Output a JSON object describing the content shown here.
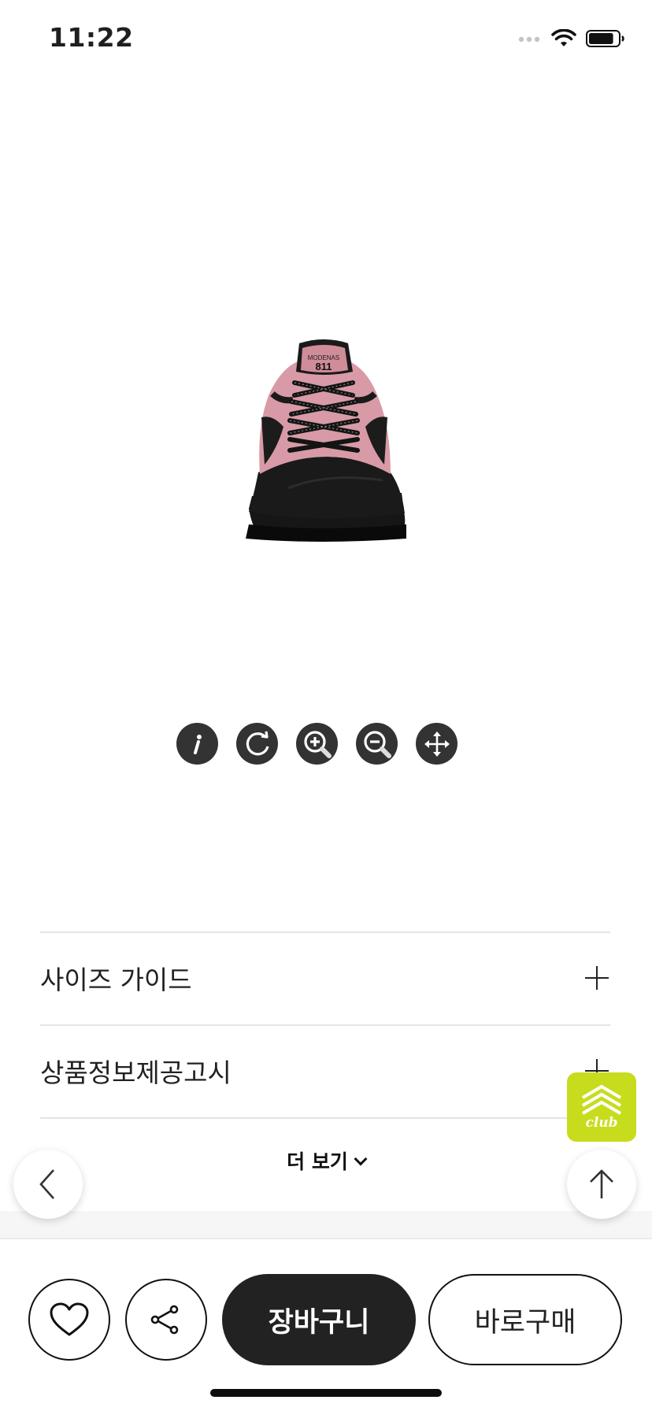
{
  "status_bar": {
    "time": "11:22",
    "battery_level": 0.85
  },
  "product_image": {
    "brand_mark": "811",
    "colors": {
      "suede": "#d99aa6",
      "mesh": "#d08a98",
      "base": "#141414"
    }
  },
  "viewer_controls": [
    "info-icon",
    "rotate-icon",
    "zoom-in-icon",
    "zoom-out-icon",
    "move-icon"
  ],
  "accordion": {
    "items": [
      {
        "label": "사이즈 가이드",
        "icon": "plus-icon"
      },
      {
        "label": "상품정보제공고시",
        "icon": "plus-icon"
      }
    ]
  },
  "more": {
    "label": "더 보기"
  },
  "club_badge": {
    "label": "club",
    "color": "#c7dc1c"
  },
  "bottom_bar": {
    "cart_label": "장바구니",
    "buy_label": "바로구매"
  }
}
